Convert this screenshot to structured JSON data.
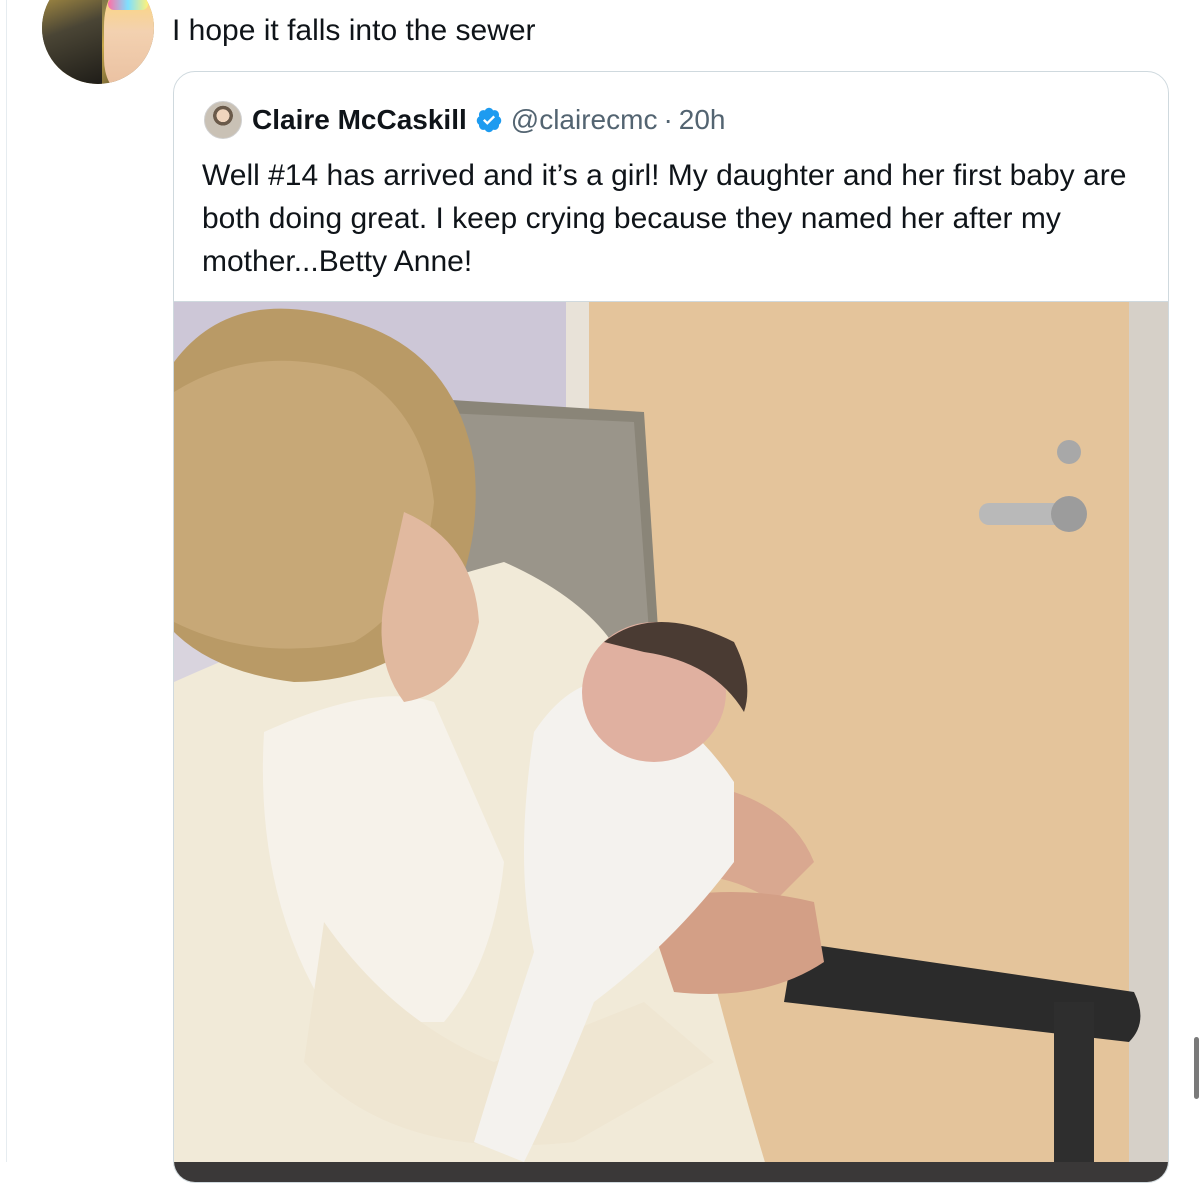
{
  "reply": {
    "text": "I hope it falls into the sewer",
    "avatar_icon": "user-avatar"
  },
  "quoted_tweet": {
    "author_name": "Claire McCaskill",
    "verified_icon": "verified-badge-icon",
    "handle": "@clairecmc",
    "separator": "·",
    "time": "20h",
    "text": "Well #14 has arrived and it’s a girl! My daughter and her first baby are both doing great. I keep crying because they named her after my mother...Betty Anne!",
    "media": "photo"
  },
  "colors": {
    "text": "#0f1419",
    "secondary": "#536471",
    "border": "#cfd9de",
    "verified": "#1d9bf0"
  }
}
